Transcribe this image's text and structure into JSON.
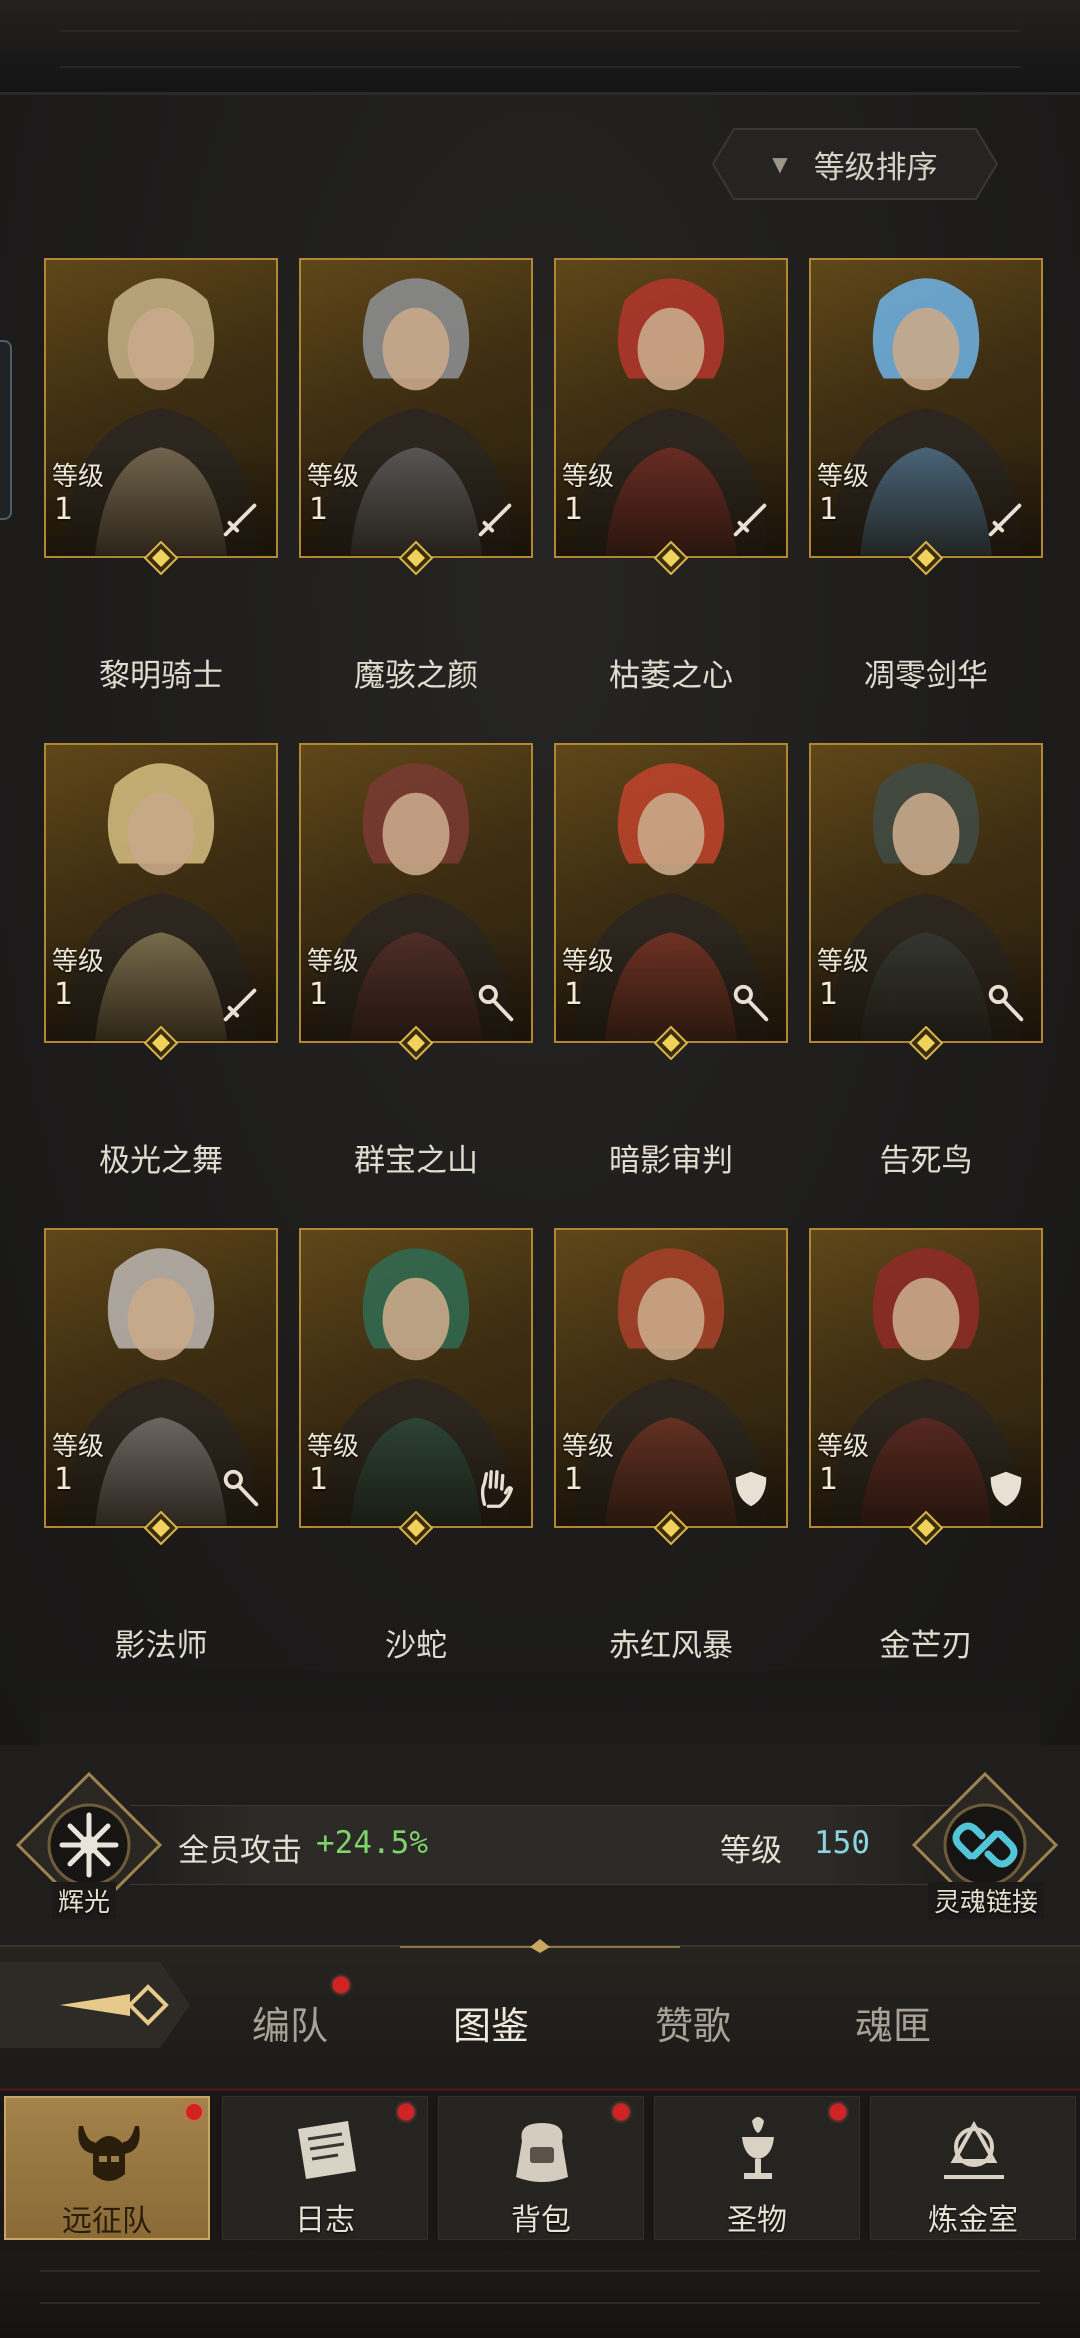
{
  "sort": {
    "label": "等级排序",
    "arrow_icon": "triangle-down-icon"
  },
  "heroes": [
    {
      "name": "黎明骑士",
      "level_label": "等级",
      "level": "1",
      "class_icon": "sword-icon",
      "accent": "#c7b48a"
    },
    {
      "name": "魔骇之颜",
      "level_label": "等级",
      "level": "1",
      "class_icon": "sword-icon",
      "accent": "#8e9296"
    },
    {
      "name": "枯萎之心",
      "level_label": "等级",
      "level": "1",
      "class_icon": "sword-icon",
      "accent": "#b3362c"
    },
    {
      "name": "凋零剑华",
      "level_label": "等级",
      "level": "1",
      "class_icon": "sword-icon",
      "accent": "#6fb4e8"
    },
    {
      "name": "极光之舞",
      "level_label": "等级",
      "level": "1",
      "class_icon": "sword-icon",
      "accent": "#d6c083"
    },
    {
      "name": "群宝之山",
      "level_label": "等级",
      "level": "1",
      "class_icon": "staff-icon",
      "accent": "#7a3a32"
    },
    {
      "name": "暗影审判",
      "level_label": "等级",
      "level": "1",
      "class_icon": "staff-icon",
      "accent": "#c0432c"
    },
    {
      "name": "告死鸟",
      "level_label": "等级",
      "level": "1",
      "class_icon": "staff-icon",
      "accent": "#3f4c46"
    },
    {
      "name": "影法师",
      "level_label": "等级",
      "level": "1",
      "class_icon": "staff-icon",
      "accent": "#bcb7b4"
    },
    {
      "name": "沙蛇",
      "level_label": "等级",
      "level": "1",
      "class_icon": "hand-icon",
      "accent": "#2f6b52"
    },
    {
      "name": "赤红风暴",
      "level_label": "等级",
      "level": "1",
      "class_icon": "shield-icon",
      "accent": "#a8402a"
    },
    {
      "name": "金芒刃",
      "level_label": "等级",
      "level": "1",
      "class_icon": "shield-icon",
      "accent": "#8f2c28"
    }
  ],
  "bonus": {
    "left_emblem_label": "辉光",
    "stat_label": "全员攻击",
    "stat_value": "+24.5%",
    "level_label": "等级",
    "level_value": "150",
    "right_emblem_label": "灵魂链接"
  },
  "tabs": [
    {
      "label": "编队",
      "badge": true
    },
    {
      "label": "图鉴",
      "active": true
    },
    {
      "label": "赞歌"
    },
    {
      "label": "魂匣"
    }
  ],
  "nav": [
    {
      "label": "远征队",
      "icon": "horned-helmet-icon",
      "active": true,
      "badge": true
    },
    {
      "label": "日志",
      "icon": "scroll-icon",
      "badge": true
    },
    {
      "label": "背包",
      "icon": "bag-icon",
      "badge": true
    },
    {
      "label": "圣物",
      "icon": "chalice-icon",
      "badge": true
    },
    {
      "label": "炼金室",
      "icon": "alchemy-icon"
    }
  ],
  "colors": {
    "gold": "#b08735",
    "badge": "#d22323",
    "bonus_green": "#7ed36a",
    "level_cyan": "#8dd5de"
  }
}
